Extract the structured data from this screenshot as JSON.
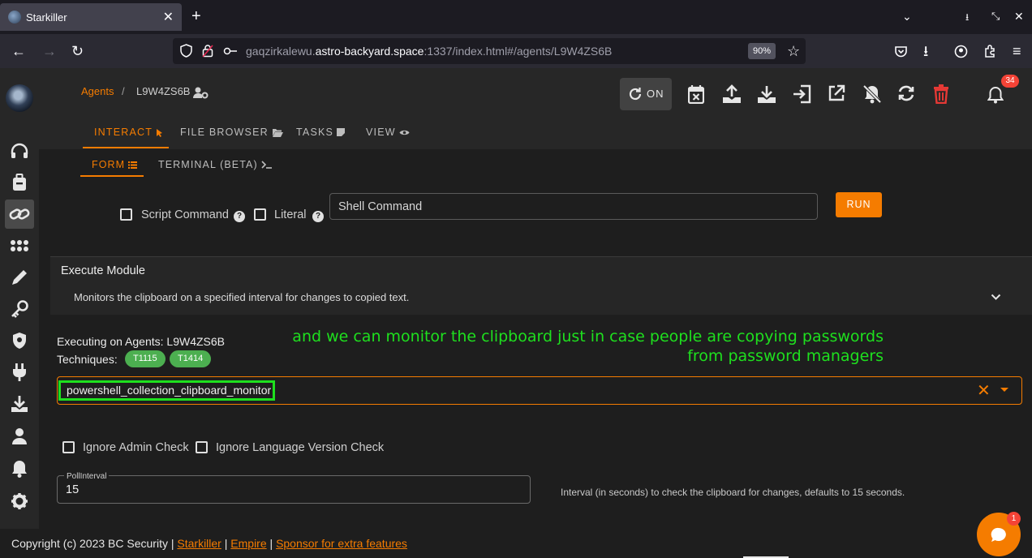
{
  "browser": {
    "tab_title": "Starkiller",
    "url_host_prefix": "gaqzirkalewu.",
    "url_host_main": "astro-backyard.space",
    "url_rest": ":1337/index.html#/agents/L9W4ZS6B",
    "zoom": "90%"
  },
  "breadcrumb": {
    "root": "Agents",
    "separator": "/",
    "current": "L9W4ZS6B"
  },
  "header": {
    "on_label": "ON",
    "notification_count": "34"
  },
  "tabs": [
    {
      "label": "INTERACT",
      "active": true
    },
    {
      "label": "FILE BROWSER",
      "active": false
    },
    {
      "label": "TASKS",
      "active": false
    },
    {
      "label": "VIEW",
      "active": false
    }
  ],
  "subtabs": [
    {
      "label": "FORM",
      "active": true
    },
    {
      "label": "TERMINAL (BETA)",
      "active": false
    }
  ],
  "shell": {
    "script_command_label": "Script Command",
    "literal_label": "Literal",
    "placeholder": "Shell Command",
    "run_label": "RUN"
  },
  "module": {
    "title": "Execute Module",
    "description": "Monitors the clipboard on a specified interval for changes to copied text.",
    "executing_on": "Executing on Agents: L9W4ZS6B",
    "techniques_label": "Techniques:",
    "techniques": [
      "T1115",
      "T1414"
    ],
    "selected": "powershell_collection_clipboard_monitor",
    "ignore_admin_label": "Ignore Admin Check",
    "ignore_lang_label": "Ignore Language Version Check",
    "poll_label": "PollInterval",
    "poll_value": "15",
    "poll_hint": "Interval (in seconds) to check the clipboard for changes, defaults to 15 seconds."
  },
  "annotation": {
    "line1": "and we can monitor the clipboard just in case people are copying passwords",
    "line2": "from password managers"
  },
  "footer": {
    "copyright": "Copyright (c) 2023 BC Security |",
    "link1": "Starkiller",
    "sep": "|",
    "link2": "Empire",
    "link3": "Sponsor for extra features"
  },
  "chat": {
    "badge": "1"
  },
  "colors": {
    "accent": "#f57c00",
    "annotation": "#1ee01e",
    "chip": "#4caf50",
    "delete": "#e53935",
    "badge": "#f44336"
  },
  "icons": {
    "sidebar": [
      "headphones-icon",
      "briefcase-icon",
      "link-icon",
      "grid-icon",
      "pen-icon",
      "key-icon",
      "shield-icon",
      "plug-icon",
      "download-icon",
      "user-icon",
      "bell-icon",
      "gear-icon"
    ],
    "header_actions": [
      "calendar-x-icon",
      "upload-icon",
      "download-icon",
      "login-icon",
      "external-link-icon",
      "bell-off-icon",
      "refresh-icon",
      "trash-icon",
      "bell-icon"
    ]
  }
}
